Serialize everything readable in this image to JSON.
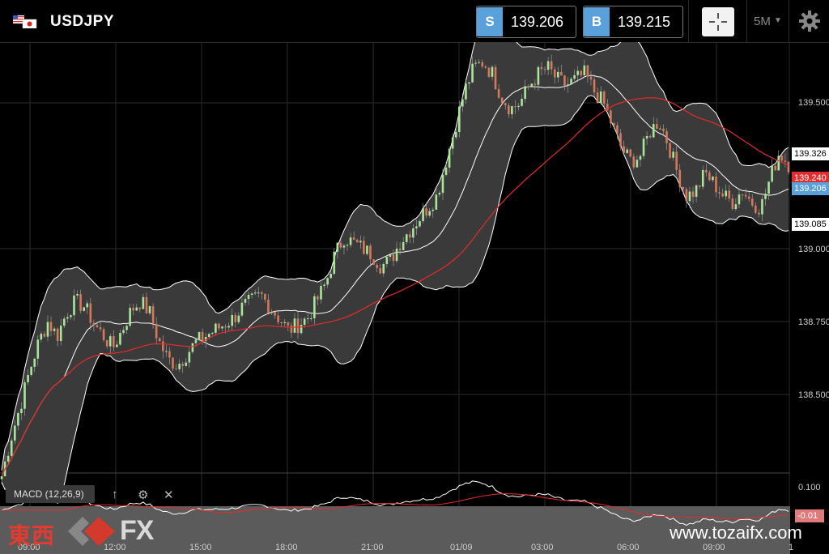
{
  "header": {
    "symbol": "USDJPY",
    "sell_tag": "S",
    "sell_price": "139.206",
    "buy_tag": "B",
    "buy_price": "139.215",
    "timeframe": "5M",
    "icons": [
      "us-jp-flag-icon",
      "crosshair-icon",
      "dropdown-caret-icon",
      "gear-icon"
    ]
  },
  "price_axis": {
    "ticks": [
      "139.500",
      "139.000",
      "138.750",
      "138.500"
    ],
    "markers": {
      "upper_band": "139.326",
      "last": "139.240",
      "bid": "139.206",
      "lower_band": "139.085"
    }
  },
  "time_axis": [
    "09:00",
    "12:00",
    "15:00",
    "18:00",
    "21:00",
    "01/09",
    "03:00",
    "06:00",
    "09:00",
    "1"
  ],
  "indicator": {
    "label": "MACD (12,26,9)",
    "axis_top": "0.100",
    "value_box": "-0.01",
    "icons": [
      "up-arrow-icon",
      "settings-icon",
      "close-icon"
    ]
  },
  "watermark": {
    "jp": "東西",
    "fx": "FX",
    "url": "www.tozaifx.com"
  },
  "colors": {
    "background": "#000000",
    "accent_blue": "#5aa0db",
    "bull_candle": "#a8e59a",
    "bear_candle": "#d9775a",
    "ma_line": "#e52b2b",
    "band_fill": "#3a3a3a",
    "band_line": "#ffffff",
    "last_price_marker": "#e52b2b"
  },
  "chart_data": {
    "type": "line",
    "ylim": [
      138.2,
      139.7
    ],
    "y_ticks": [
      138.5,
      138.75,
      139.0,
      139.5
    ],
    "grid": true,
    "close_price_approx": [
      138.22,
      138.35,
      138.46,
      138.58,
      138.68,
      138.75,
      138.7,
      138.78,
      138.82,
      138.8,
      138.74,
      138.7,
      138.66,
      138.72,
      138.79,
      138.82,
      138.78,
      138.68,
      138.62,
      138.6,
      138.64,
      138.68,
      138.7,
      138.72,
      138.74,
      138.76,
      138.8,
      138.82,
      138.84,
      138.8,
      138.76,
      138.72,
      138.74,
      138.76,
      138.82,
      138.88,
      138.98,
      139.04,
      139.02,
      139.0,
      138.98,
      138.94,
      138.96,
      139.02,
      139.06,
      139.1,
      139.14,
      139.18,
      139.3,
      139.42,
      139.54,
      139.62,
      139.64,
      139.6,
      139.52,
      139.48,
      139.5,
      139.56,
      139.6,
      139.62,
      139.58,
      139.56,
      139.58,
      139.6,
      139.54,
      139.5,
      139.42,
      139.34,
      139.3,
      139.32,
      139.4,
      139.44,
      139.36,
      139.26,
      139.18,
      139.2,
      139.26,
      139.22,
      139.18,
      139.16,
      139.2,
      139.16,
      139.14,
      139.24,
      139.33,
      139.29
    ]
  }
}
